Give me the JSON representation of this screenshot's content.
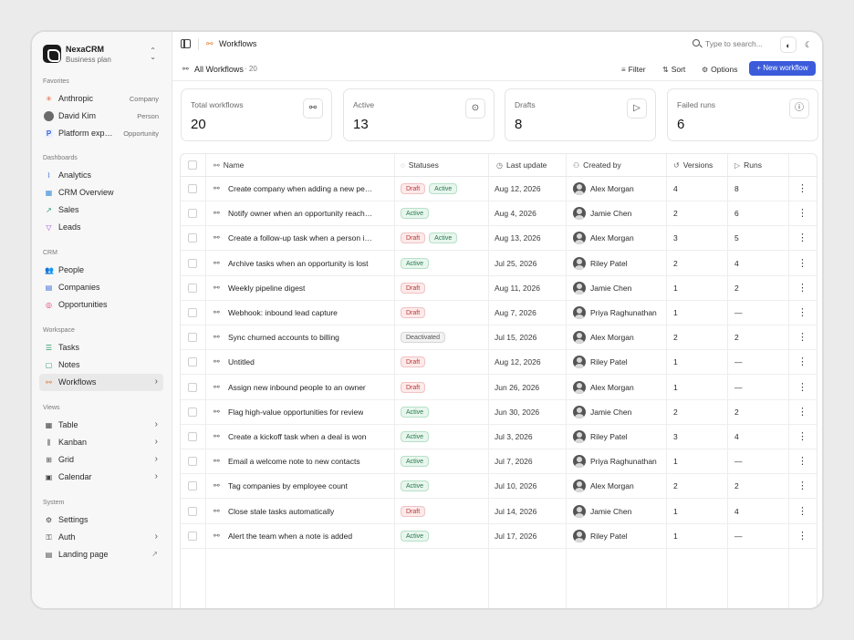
{
  "workspace": {
    "name": "NexaCRM",
    "plan": "Business plan"
  },
  "sidebar": {
    "favorites_label": "Favorites",
    "favorites": [
      {
        "label": "Anthropic",
        "tag": "Company",
        "icon": "asterisk-icon"
      },
      {
        "label": "David Kim",
        "tag": "Person",
        "icon": "avatar"
      },
      {
        "label": "Platform expansion",
        "tag": "Opportunity",
        "icon": "p-badge"
      }
    ],
    "dashboards_label": "Dashboards",
    "dashboards": [
      {
        "label": "Analytics",
        "icon": "chart-icon"
      },
      {
        "label": "CRM Overview",
        "icon": "grid-icon"
      },
      {
        "label": "Sales",
        "icon": "trending-icon"
      },
      {
        "label": "Leads",
        "icon": "funnel-icon"
      }
    ],
    "crm_label": "CRM",
    "crm": [
      {
        "label": "People",
        "icon": "people-icon"
      },
      {
        "label": "Companies",
        "icon": "building-icon"
      },
      {
        "label": "Opportunities",
        "icon": "target-icon"
      }
    ],
    "workspace_label": "Workspace",
    "workspace_items": [
      {
        "label": "Tasks",
        "icon": "checklist-icon"
      },
      {
        "label": "Notes",
        "icon": "note-icon"
      },
      {
        "label": "Workflows",
        "icon": "workflow-icon"
      }
    ],
    "views_label": "Views",
    "views": [
      {
        "label": "Table",
        "icon": "table-icon"
      },
      {
        "label": "Kanban",
        "icon": "kanban-icon"
      },
      {
        "label": "Grid",
        "icon": "grid-icon"
      },
      {
        "label": "Calendar",
        "icon": "calendar-icon"
      }
    ],
    "system_label": "System",
    "system": [
      {
        "label": "Settings",
        "icon": "gear-icon"
      },
      {
        "label": "Auth",
        "icon": "key-icon"
      },
      {
        "label": "Landing page",
        "icon": "layout-icon"
      }
    ]
  },
  "topbar": {
    "breadcrumb": "Workflows",
    "search_placeholder": "Type to search..."
  },
  "viewbar": {
    "view_label": "All Workflows",
    "count": "· 20",
    "filter": "Filter",
    "sort": "Sort",
    "options": "Options",
    "new_workflow": "+ New workflow"
  },
  "stats": [
    {
      "label": "Total workflows",
      "value": "20",
      "icon": "workflow-icon"
    },
    {
      "label": "Active",
      "value": "13",
      "icon": "play-circle-icon"
    },
    {
      "label": "Drafts",
      "value": "8",
      "icon": "play-icon"
    },
    {
      "label": "Failed runs",
      "value": "6",
      "icon": "alert-circle-icon"
    }
  ],
  "table": {
    "columns": {
      "name": "Name",
      "statuses": "Statuses",
      "last_update": "Last update",
      "created_by": "Created by",
      "versions": "Versions",
      "runs": "Runs"
    },
    "rows": [
      {
        "name": "Create company when adding a new person",
        "statuses": [
          "Draft",
          "Active"
        ],
        "date": "Aug 12, 2026",
        "creator": "Alex Morgan",
        "versions": "4",
        "runs": "8"
      },
      {
        "name": "Notify owner when an opportunity reaches stage",
        "statuses": [
          "Active"
        ],
        "date": "Aug 4, 2026",
        "creator": "Jamie Chen",
        "versions": "2",
        "runs": "6"
      },
      {
        "name": "Create a follow-up task when a person is added",
        "statuses": [
          "Draft",
          "Active"
        ],
        "date": "Aug 13, 2026",
        "creator": "Alex Morgan",
        "versions": "3",
        "runs": "5"
      },
      {
        "name": "Archive tasks when an opportunity is lost",
        "statuses": [
          "Active"
        ],
        "date": "Jul 25, 2026",
        "creator": "Riley Patel",
        "versions": "2",
        "runs": "4"
      },
      {
        "name": "Weekly pipeline digest",
        "statuses": [
          "Draft"
        ],
        "date": "Aug 11, 2026",
        "creator": "Jamie Chen",
        "versions": "1",
        "runs": "2"
      },
      {
        "name": "Webhook: inbound lead capture",
        "statuses": [
          "Draft"
        ],
        "date": "Aug 7, 2026",
        "creator": "Priya Raghunathan",
        "versions": "1",
        "runs": "—"
      },
      {
        "name": "Sync churned accounts to billing",
        "statuses": [
          "Deactivated"
        ],
        "date": "Jul 15, 2026",
        "creator": "Alex Morgan",
        "versions": "2",
        "runs": "2"
      },
      {
        "name": "Untitled",
        "statuses": [
          "Draft"
        ],
        "date": "Aug 12, 2026",
        "creator": "Riley Patel",
        "versions": "1",
        "runs": "—"
      },
      {
        "name": "Assign new inbound people to an owner",
        "statuses": [
          "Draft"
        ],
        "date": "Jun 26, 2026",
        "creator": "Alex Morgan",
        "versions": "1",
        "runs": "—"
      },
      {
        "name": "Flag high-value opportunities for review",
        "statuses": [
          "Active"
        ],
        "date": "Jun 30, 2026",
        "creator": "Jamie Chen",
        "versions": "2",
        "runs": "2"
      },
      {
        "name": "Create a kickoff task when a deal is won",
        "statuses": [
          "Active"
        ],
        "date": "Jul 3, 2026",
        "creator": "Riley Patel",
        "versions": "3",
        "runs": "4"
      },
      {
        "name": "Email a welcome note to new contacts",
        "statuses": [
          "Active"
        ],
        "date": "Jul 7, 2026",
        "creator": "Priya Raghunathan",
        "versions": "1",
        "runs": "—"
      },
      {
        "name": "Tag companies by employee count",
        "statuses": [
          "Active"
        ],
        "date": "Jul 10, 2026",
        "creator": "Alex Morgan",
        "versions": "2",
        "runs": "2"
      },
      {
        "name": "Close stale tasks automatically",
        "statuses": [
          "Draft"
        ],
        "date": "Jul 14, 2026",
        "creator": "Jamie Chen",
        "versions": "1",
        "runs": "4"
      },
      {
        "name": "Alert the team when a note is added",
        "statuses": [
          "Active"
        ],
        "date": "Jul 17, 2026",
        "creator": "Riley Patel",
        "versions": "1",
        "runs": "—"
      }
    ]
  },
  "colors": {
    "accent": "#3b5bdb",
    "draft": "#b73a3a",
    "active": "#25794a",
    "workflow_orange": "#e07a2e"
  }
}
